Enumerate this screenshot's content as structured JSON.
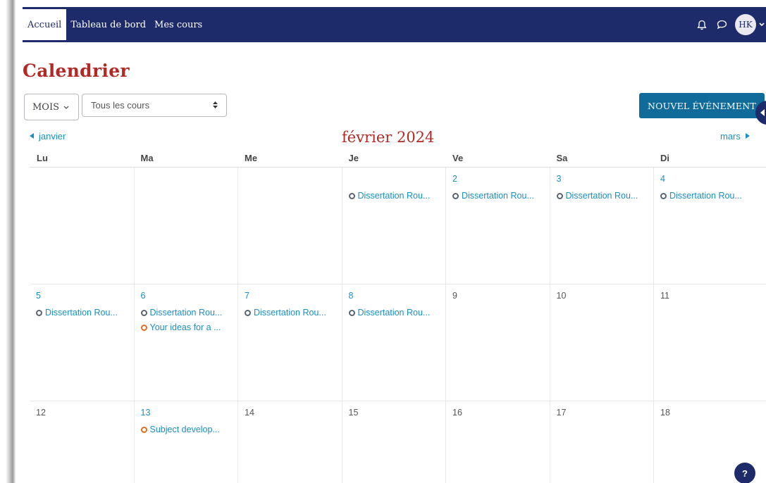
{
  "navbar": {
    "links": [
      "Accueil",
      "Tableau de bord",
      "Mes cours"
    ],
    "avatar_initials": "HK"
  },
  "page": {
    "title": "Calendrier"
  },
  "controls": {
    "view_select": "MOIS",
    "course_select": "Tous les cours",
    "new_event_label": "NOUVEL ÉVÉNEMENT"
  },
  "calendar": {
    "prev_month": "janvier",
    "next_month": "mars",
    "month_title": "février 2024",
    "weekdays": [
      "Lu",
      "Ma",
      "Me",
      "Je",
      "Ve",
      "Sa",
      "Di"
    ],
    "weeks": [
      [
        {
          "day": "",
          "events": []
        },
        {
          "day": "",
          "events": []
        },
        {
          "day": "",
          "events": []
        },
        {
          "day": "",
          "events": [
            {
              "label": "Dissertation Rou...",
              "color": "gray"
            }
          ]
        },
        {
          "day": "2",
          "events": [
            {
              "label": "Dissertation Rou...",
              "color": "gray"
            }
          ]
        },
        {
          "day": "3",
          "events": [
            {
              "label": "Dissertation Rou...",
              "color": "gray"
            }
          ]
        },
        {
          "day": "4",
          "events": [
            {
              "label": "Dissertation Rou...",
              "color": "gray"
            }
          ]
        }
      ],
      [
        {
          "day": "5",
          "events": [
            {
              "label": "Dissertation Rou...",
              "color": "gray"
            }
          ]
        },
        {
          "day": "6",
          "events": [
            {
              "label": "Dissertation Rou...",
              "color": "gray"
            },
            {
              "label": "Your ideas for a ...",
              "color": "orange"
            }
          ]
        },
        {
          "day": "7",
          "events": [
            {
              "label": "Dissertation Rou...",
              "color": "gray"
            }
          ]
        },
        {
          "day": "8",
          "events": [
            {
              "label": "Dissertation Rou...",
              "color": "gray"
            }
          ]
        },
        {
          "day": "9",
          "events": []
        },
        {
          "day": "10",
          "events": []
        },
        {
          "day": "11",
          "events": []
        }
      ],
      [
        {
          "day": "12",
          "events": []
        },
        {
          "day": "13",
          "events": [
            {
              "label": "Subject develop...",
              "color": "orange"
            }
          ]
        },
        {
          "day": "14",
          "events": []
        },
        {
          "day": "15",
          "events": []
        },
        {
          "day": "16",
          "events": []
        },
        {
          "day": "17",
          "events": []
        },
        {
          "day": "18",
          "events": []
        }
      ]
    ]
  },
  "colors": {
    "navbar": "#1d2b6b",
    "title": "#b22a25",
    "link": "#1a8fc1",
    "primary_button": "#106b9a",
    "event_gray": "#5a6470",
    "event_orange": "#e46c1f"
  },
  "help_label": "?"
}
